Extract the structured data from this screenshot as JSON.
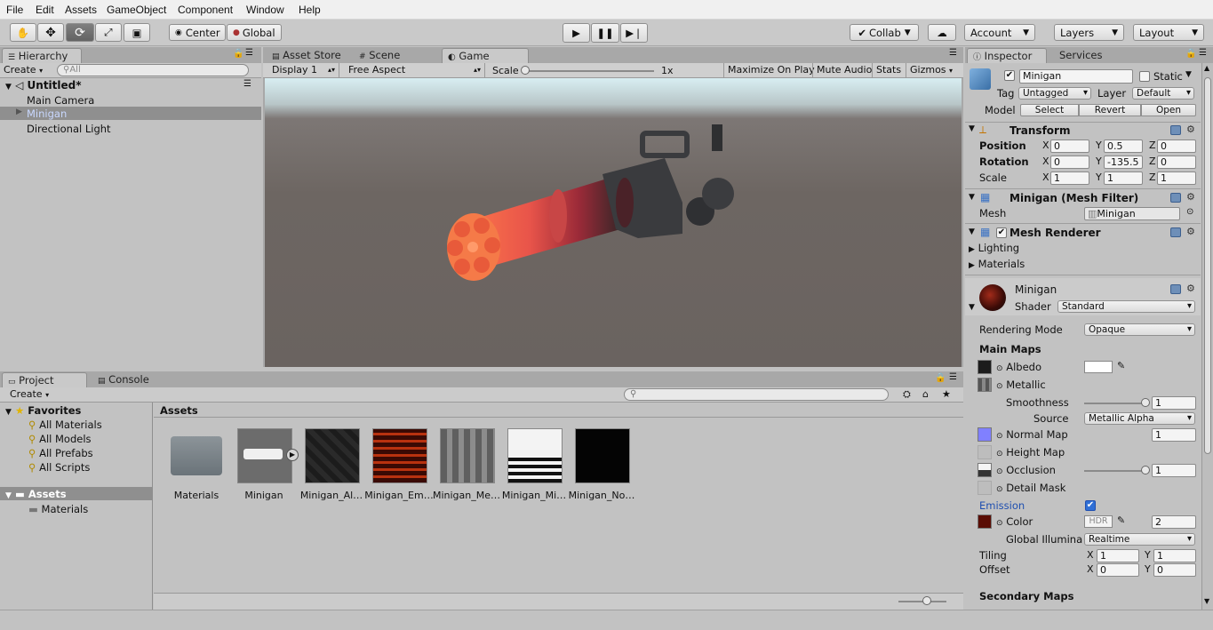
{
  "menu": [
    "File",
    "Edit",
    "Assets",
    "GameObject",
    "Component",
    "Window",
    "Help"
  ],
  "toolbar": {
    "pivot": "Center",
    "space": "Global",
    "collab": "Collab",
    "account": "Account",
    "layers": "Layers",
    "layout": "Layout"
  },
  "hierarchy": {
    "tab": "Hierarchy",
    "create": "Create",
    "search_placeholder": "All",
    "scene": "Untitled*",
    "items": [
      "Main Camera",
      "Minigan",
      "Directional Light"
    ]
  },
  "center_tabs": [
    "Asset Store",
    "Scene",
    "Game"
  ],
  "game": {
    "display": "Display 1",
    "aspect": "Free Aspect",
    "scale_label": "Scale",
    "scale_value": "1x",
    "buttons": [
      "Maximize On Play",
      "Mute Audio",
      "Stats",
      "Gizmos"
    ]
  },
  "project": {
    "tabs": [
      "Project",
      "Console"
    ],
    "create": "Create",
    "favorites_title": "Favorites",
    "favorites": [
      "All Materials",
      "All Models",
      "All Prefabs",
      "All Scripts"
    ],
    "assets_title": "Assets",
    "asset_folders": [
      "Materials"
    ],
    "breadcrumb": "Assets",
    "items": [
      "Materials",
      "Minigan",
      "Minigan_Al…",
      "Minigan_Em…",
      "Minigan_Me…",
      "Minigan_Mi…",
      "Minigan_No…"
    ]
  },
  "inspector": {
    "tabs": [
      "Inspector",
      "Services"
    ],
    "object_name": "Minigan",
    "static_label": "Static",
    "tag_label": "Tag",
    "tag_value": "Untagged",
    "layer_label": "Layer",
    "layer_value": "Default",
    "model_label": "Model",
    "model_buttons": [
      "Select",
      "Revert",
      "Open"
    ],
    "transform": {
      "title": "Transform",
      "position_label": "Position",
      "rotation_label": "Rotation",
      "scale_label": "Scale",
      "position": {
        "x": "0",
        "y": "0.5",
        "z": "0"
      },
      "rotation": {
        "x": "0",
        "y": "-135.5",
        "z": "0"
      },
      "scale": {
        "x": "1",
        "y": "1",
        "z": "1"
      }
    },
    "mesh_filter": {
      "title": "Minigan (Mesh Filter)",
      "mesh_label": "Mesh",
      "mesh_value": "Minigan"
    },
    "mesh_renderer": {
      "title": "Mesh Renderer",
      "lighting": "Lighting",
      "materials": "Materials"
    },
    "material": {
      "name": "Minigan",
      "shader_label": "Shader",
      "shader_value": "Standard",
      "rendering_mode_label": "Rendering Mode",
      "rendering_mode_value": "Opaque",
      "main_maps": "Main Maps",
      "albedo": "Albedo",
      "metallic": "Metallic",
      "smoothness_label": "Smoothness",
      "smoothness_value": "1",
      "source_label": "Source",
      "source_value": "Metallic Alpha",
      "normal_map": "Normal Map",
      "normal_value": "1",
      "height_map": "Height Map",
      "occlusion": "Occlusion",
      "occlusion_value": "1",
      "detail_mask": "Detail Mask",
      "emission": "Emission",
      "color_label": "Color",
      "hdr": "HDR",
      "emission_value": "2",
      "gi_label": "Global Illuminat",
      "gi_value": "Realtime",
      "tiling_label": "Tiling",
      "offset_label": "Offset",
      "tiling": {
        "x": "1",
        "y": "1"
      },
      "offset": {
        "x": "0",
        "y": "0"
      },
      "axis_x": "X",
      "axis_y": "Y",
      "axis_z": "Z",
      "secondary_maps": "Secondary Maps"
    }
  },
  "colors": {
    "accent": "#3a72c4",
    "emission_label": "#1f4fb0",
    "background": "#c2c2c2"
  }
}
